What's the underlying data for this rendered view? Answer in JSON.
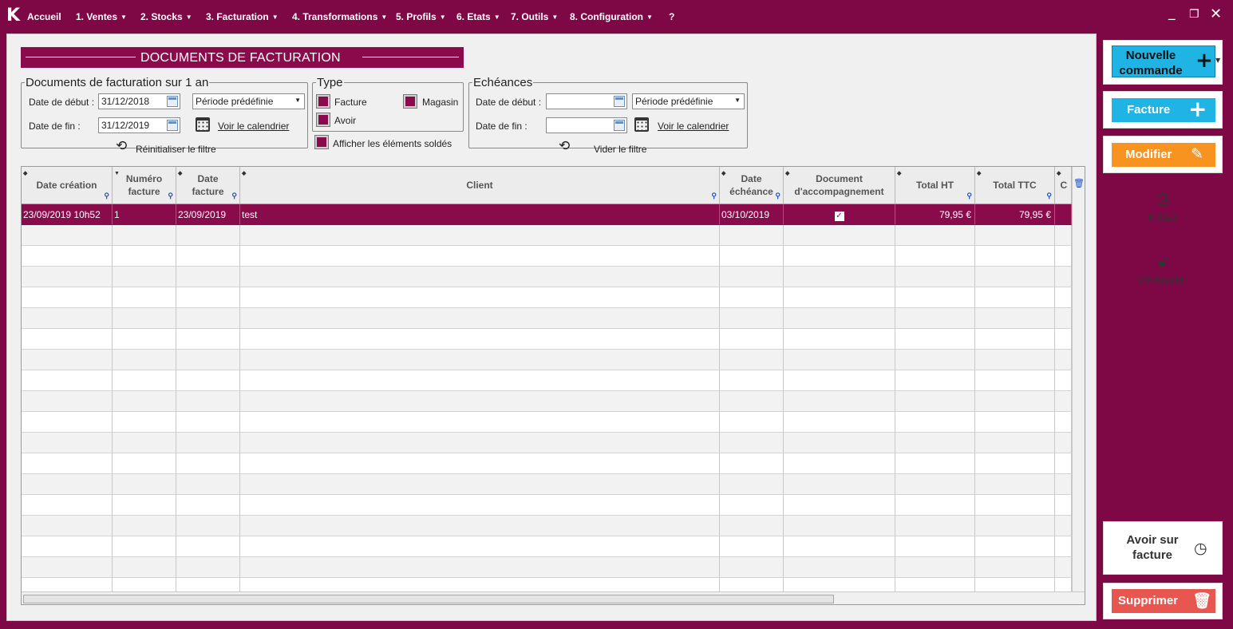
{
  "menu": {
    "logo": "K",
    "items": [
      {
        "label": "Accueil"
      },
      {
        "label": "1. Ventes"
      },
      {
        "label": "2. Stocks"
      },
      {
        "label": "3. Facturation"
      },
      {
        "label": "4. Transformations"
      },
      {
        "label": "5. Profils"
      },
      {
        "label": "6. Etats"
      },
      {
        "label": "7. Outils"
      },
      {
        "label": "8. Configuration"
      },
      {
        "label": "?"
      }
    ]
  },
  "title": "DOCUMENTS DE FACTURATION",
  "filters": {
    "period": {
      "title": "Documents de facturation sur 1 an",
      "start_label": "Date de début :",
      "start_value": "31/12/2018",
      "end_label": "Date de fin :",
      "end_value": "31/12/2019",
      "preset": "Période prédéfinie",
      "calendar_link": "Voir le calendrier",
      "reset_label": "Réinitialiser le filtre"
    },
    "type": {
      "title": "Type",
      "facture": "Facture",
      "magasin": "Magasin",
      "avoir": "Avoir",
      "show_paid": "Afficher les éléments soldés"
    },
    "due": {
      "title": "Echéances",
      "start_label": "Date de début :",
      "start_value": "",
      "end_label": "Date de fin :",
      "end_value": "",
      "preset": "Période prédéfinie",
      "calendar_link": "Voir le calendrier",
      "reset_label": "Vider le filtre"
    }
  },
  "grid": {
    "columns": [
      "Date création",
      "Numéro facture",
      "Date facture",
      "Client",
      "Date échéance",
      "Document d'accompagnement",
      "Total HT",
      "Total TTC",
      "C"
    ],
    "rows": [
      {
        "date_creation": "23/09/2019 10h52",
        "numero": "1",
        "date_facture": "23/09/2019",
        "client": "test",
        "date_echeance": "03/10/2019",
        "accompagnement": "✓",
        "total_ht": "79,95 €",
        "total_ttc": "79,95 €"
      }
    ]
  },
  "actions": {
    "nouvelle_commande": "Nouvelle commande",
    "facture": "Facture",
    "modifier": "Modifier",
    "editer": "Editer",
    "verrouiller": "Verrouiller",
    "avoir_sur_facture": "Avoir sur facture",
    "supprimer": "Supprimer"
  },
  "colors": {
    "brand": "#7e0846",
    "accent_blue": "#1fb4e4",
    "accent_orange": "#f7931e",
    "danger": "#e8574f"
  }
}
